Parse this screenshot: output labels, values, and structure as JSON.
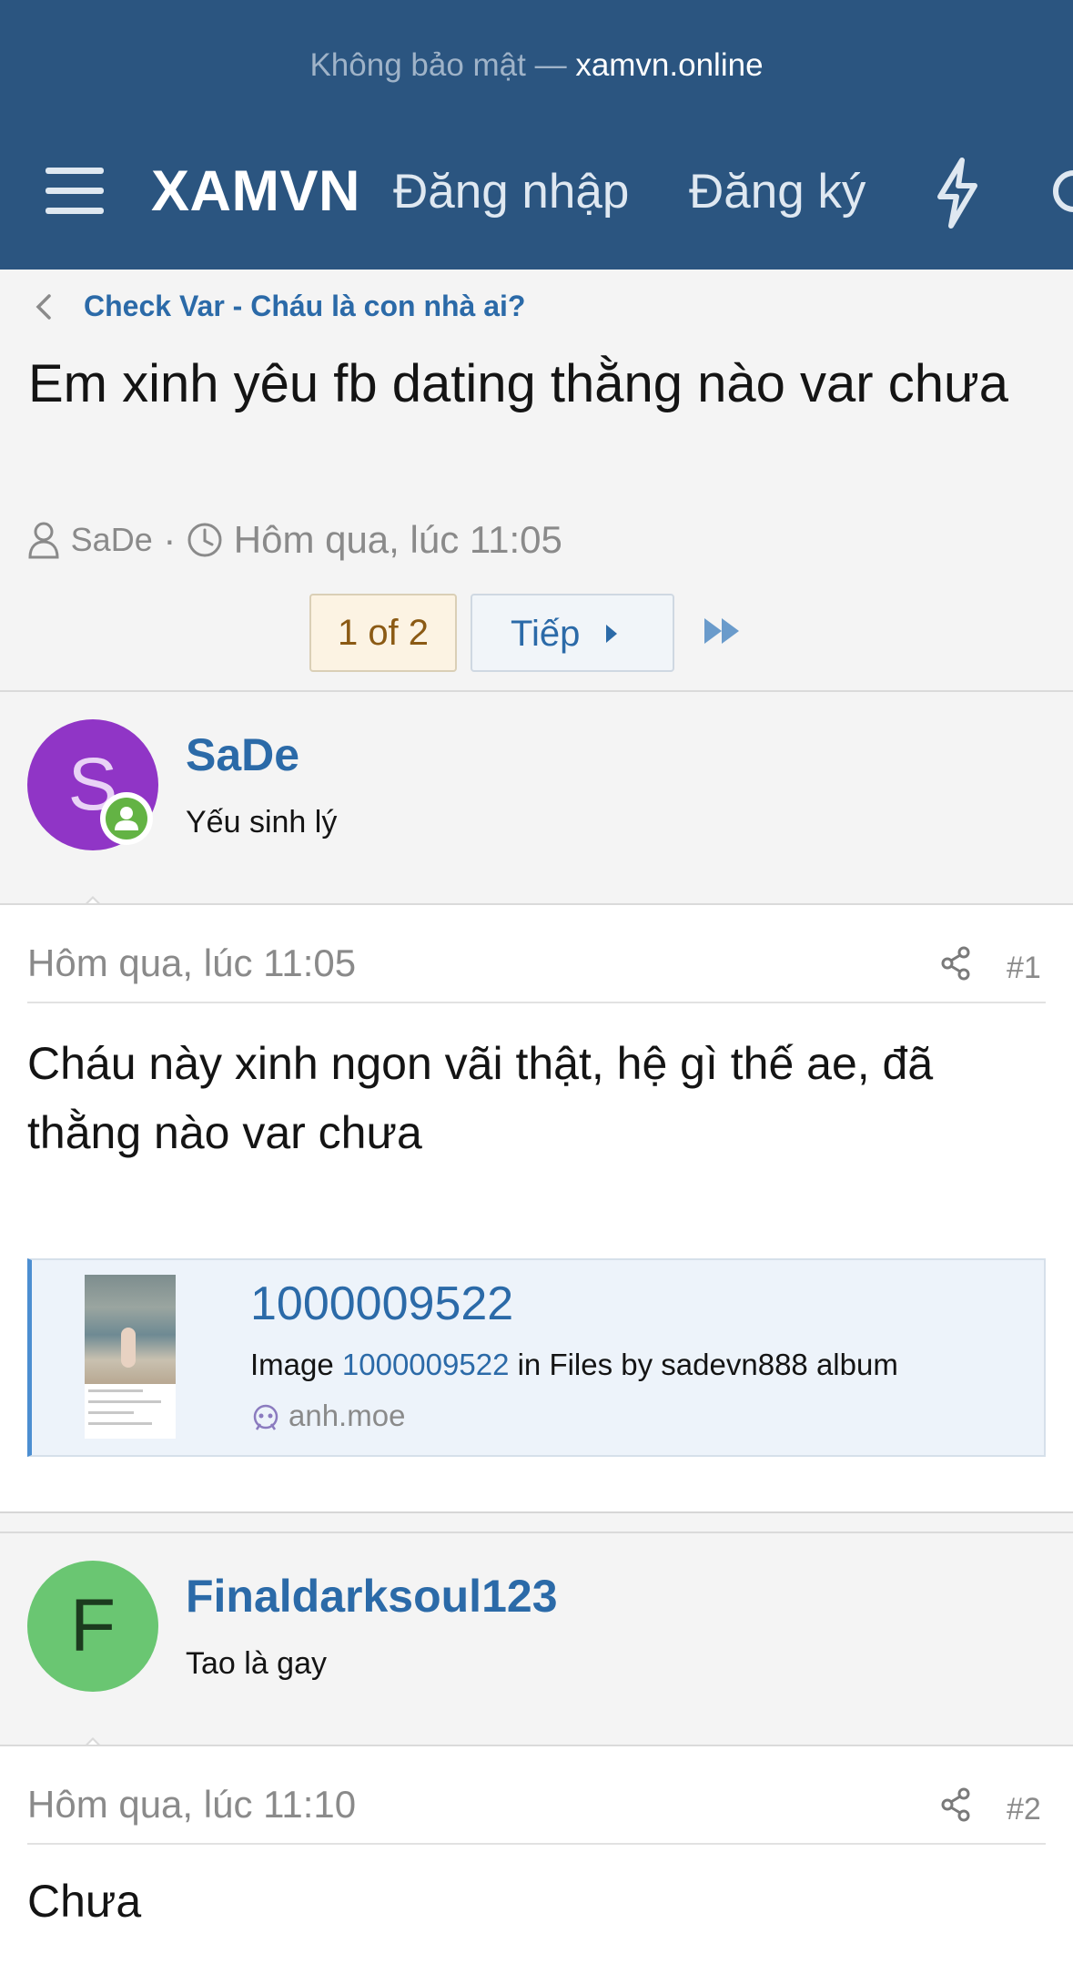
{
  "browser": {
    "security_label": "Không bảo mật —",
    "domain": "xamvn.online"
  },
  "nav": {
    "brand": "XAMVN",
    "login": "Đăng nhập",
    "register": "Đăng ký"
  },
  "breadcrumb": {
    "label": "Check Var - Cháu là con nhà ai?"
  },
  "thread": {
    "title": "Em xinh yêu fb dating thằng nào var chưa",
    "author": "SaDe",
    "separator": "·",
    "date": "Hôm qua, lúc 11:05"
  },
  "pager": {
    "current": "1 of 2",
    "next": "Tiếp"
  },
  "posts": [
    {
      "avatar_letter": "S",
      "avatar_color": "#9035c6",
      "username": "SaDe",
      "user_title": "Yếu sinh lý",
      "date": "Hôm qua, lúc 11:05",
      "number": "#1",
      "text": "Cháu này xinh ngon vãi thật, hệ gì thế ae, đã thằng nào var chưa",
      "embed": {
        "title": "1000009522",
        "desc_prefix": "Image",
        "desc_link": "1000009522",
        "desc_suffix": "in Files by sadevn888 album",
        "site": "anh.moe"
      }
    },
    {
      "avatar_letter": "F",
      "avatar_color": "#6ac672",
      "username": "Finaldarksoul123",
      "user_title": "Tao là gay",
      "date": "Hôm qua, lúc 11:10",
      "number": "#2",
      "text": "Chưa"
    }
  ],
  "icons": {
    "menu": "hamburger-menu-icon",
    "whats_new": "lightning-bolt-icon",
    "search": "search-icon",
    "back": "chevron-left-icon",
    "user": "user-icon",
    "clock": "clock-icon",
    "share": "share-icon",
    "next": "triangle-right-icon",
    "last": "double-triangle-right-icon",
    "site": "anh-moe-icon"
  },
  "colors": {
    "header_bg": "#2b5580",
    "link": "#2b6aa8",
    "online": "#63b344"
  }
}
